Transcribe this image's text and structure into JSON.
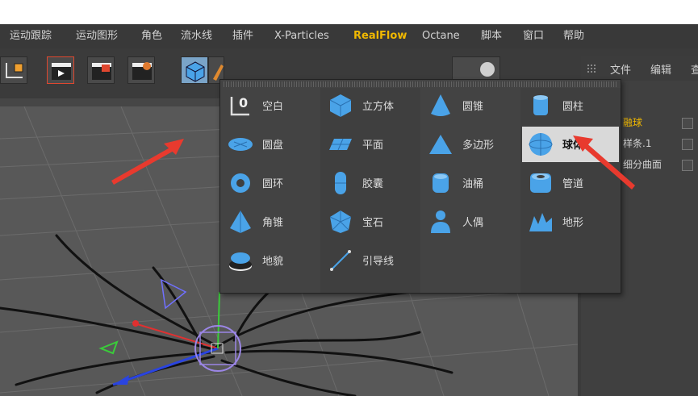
{
  "menu": [
    "运动跟踪",
    "运动图形",
    "角色",
    "流水线",
    "插件",
    "X-Particles",
    "RealFlow",
    "Octane",
    "脚本",
    "窗口",
    "帮助"
  ],
  "menu_highlight": "RealFlow",
  "object_manager": {
    "tabs": [
      "文件",
      "编辑",
      "查"
    ],
    "rows": [
      "融球",
      "样条.1",
      "细分曲面"
    ]
  },
  "popup": {
    "tools": [
      [
        "空白",
        "立方体",
        "圆锥",
        "圆柱"
      ],
      [
        "圆盘",
        "平面",
        "多边形",
        "球体"
      ],
      [
        "圆环",
        "胶囊",
        "油桶",
        "管道"
      ],
      [
        "角锥",
        "宝石",
        "人偶",
        "地形"
      ],
      [
        "地貌",
        "引导线"
      ]
    ],
    "selected": "球体"
  },
  "colors": {
    "accent": "#f0b800",
    "arrow": "#e83a2e",
    "icon_blue": "#4aa3e8",
    "selected_bg": "#d9d9d9"
  }
}
